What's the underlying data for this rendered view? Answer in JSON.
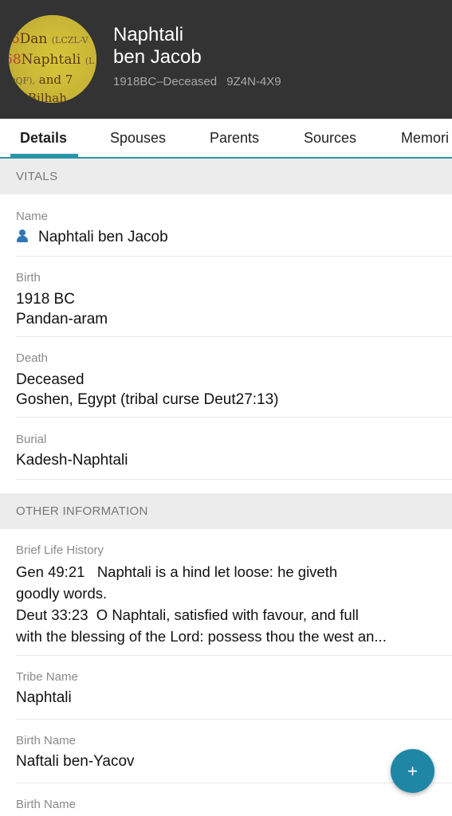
{
  "person": {
    "name_line1": "Naphtali",
    "name_line2": "ben Jacob",
    "lifespan": "1918BC–Deceased",
    "id": "9Z4N-4X9",
    "avatar_text": {
      "line1_name": "Dan",
      "line1_code": "(LCZL-V",
      "line2_num": "68",
      "line2_name": "Naphtali",
      "line2_code": "(L",
      "line3_code": "-DQF),",
      "line3_text": "and 7",
      "line4_text": "Bilhah"
    }
  },
  "tabs": [
    "Details",
    "Spouses",
    "Parents",
    "Sources",
    "Memori"
  ],
  "sections": {
    "vitals_title": "VITALS",
    "other_title": "OTHER INFORMATION"
  },
  "vitals": {
    "name_label": "Name",
    "name_value": "Naphtali ben Jacob",
    "birth_label": "Birth",
    "birth_date": "1918 BC",
    "birth_place": "Pandan-aram",
    "death_label": "Death",
    "death_date": "Deceased",
    "death_place": "Goshen, Egypt (tribal curse Deut27:13)",
    "burial_label": "Burial",
    "burial_place": "Kadesh-Naphtali"
  },
  "other": {
    "history_label": "Brief Life History",
    "history_line1": "Gen 49:21   Naphtali is a hind let loose: he giveth",
    "history_line2": "goodly words.",
    "history_line3": "Deut 33:23  O Naphtali, satisfied with favour, and full",
    "history_line4": "with the blessing of the Lord: possess thou the west an...",
    "tribe_label": "Tribe Name",
    "tribe_value": "Naphtali",
    "birthname_label": "Birth Name",
    "birthname_value": "Naftali ben-Yacov",
    "birthname2_label": "Birth Name"
  },
  "fab": {
    "label": "+"
  },
  "colors": {
    "header_bg": "#333333",
    "accent": "#2b95a8",
    "fab": "#1f86a6",
    "section_bg": "#ececec"
  },
  "icons": {
    "name_icon": "person-icon",
    "fab_icon": "plus-icon"
  }
}
